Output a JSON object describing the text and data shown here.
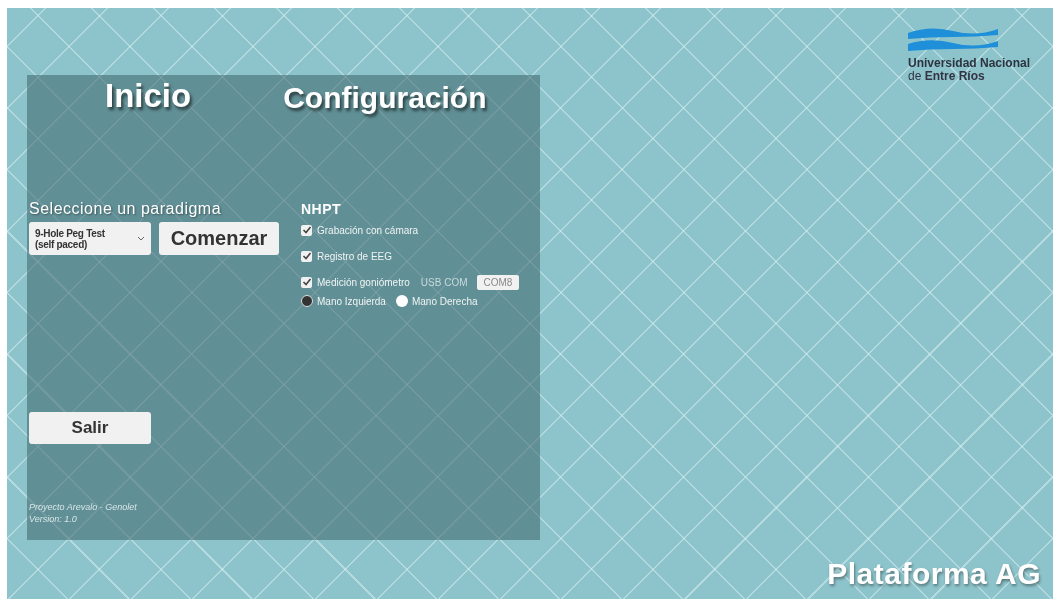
{
  "logo": {
    "line_1": "Universidad Nacional",
    "line_2_prefix": "de",
    "line_2_bold": "Entre Ríos"
  },
  "nav": [
    {
      "label": "Inicio"
    },
    {
      "label": "Configuración"
    }
  ],
  "paradigm": {
    "label": "Seleccione un paradigma",
    "dropdown_value": "9-Hole Peg Test (self paced)",
    "start_button": "Comenzar"
  },
  "exit_button": "Salir",
  "footer": [
    "Proyecto Arevalo - Genolet",
    "Version: 1.0"
  ],
  "config": {
    "title": "NHPT",
    "options": [
      {
        "kind": "checkbox",
        "label": "Grabación con cámara",
        "checked": true
      },
      {
        "kind": "checkbox",
        "label": "Registro de EEG",
        "checked": true
      },
      {
        "kind": "port",
        "label": "Medición goniómetro",
        "checked": true,
        "port_label": "USB COM",
        "port_value": "COM8"
      }
    ],
    "hands": [
      {
        "label": "Mano Izquierda",
        "selected": true
      },
      {
        "label": "Mano Derecha",
        "selected": false
      }
    ]
  },
  "app_title": "Plataforma AG"
}
